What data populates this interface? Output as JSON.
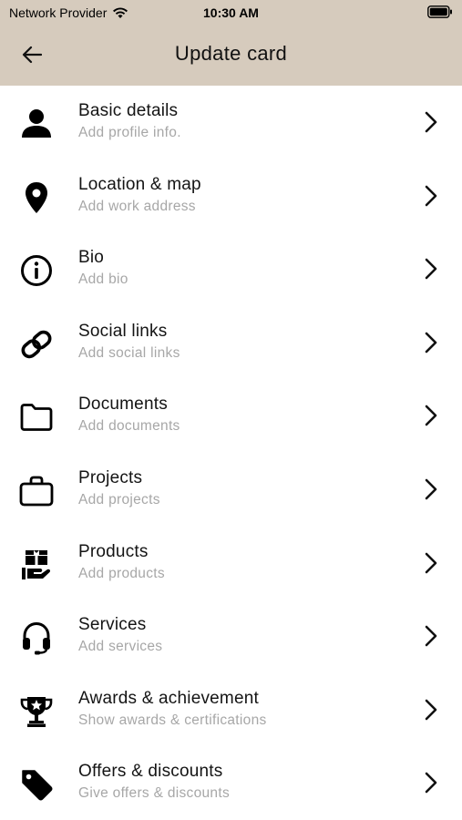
{
  "status_bar": {
    "carrier": "Network Provider",
    "time": "10:30 AM"
  },
  "header": {
    "title": "Update card",
    "background": "#d6cbbd"
  },
  "items": [
    {
      "label": "Basic details",
      "sub": "Add profile info.",
      "icon": "person-icon"
    },
    {
      "label": "Location & map",
      "sub": "Add work address",
      "icon": "location-pin-icon"
    },
    {
      "label": "Bio",
      "sub": "Add bio",
      "icon": "info-icon"
    },
    {
      "label": "Social links",
      "sub": "Add social links",
      "icon": "link-icon"
    },
    {
      "label": "Documents",
      "sub": "Add documents",
      "icon": "folder-icon"
    },
    {
      "label": "Projects",
      "sub": "Add projects",
      "icon": "bag-icon"
    },
    {
      "label": "Products",
      "sub": "Add products",
      "icon": "product-box-icon"
    },
    {
      "label": "Services",
      "sub": "Add services",
      "icon": "headphones-icon"
    },
    {
      "label": "Awards & achievement",
      "sub": "Show awards & certifications",
      "icon": "trophy-icon"
    },
    {
      "label": "Offers & discounts",
      "sub": "Give offers & discounts",
      "icon": "tag-icon"
    }
  ]
}
